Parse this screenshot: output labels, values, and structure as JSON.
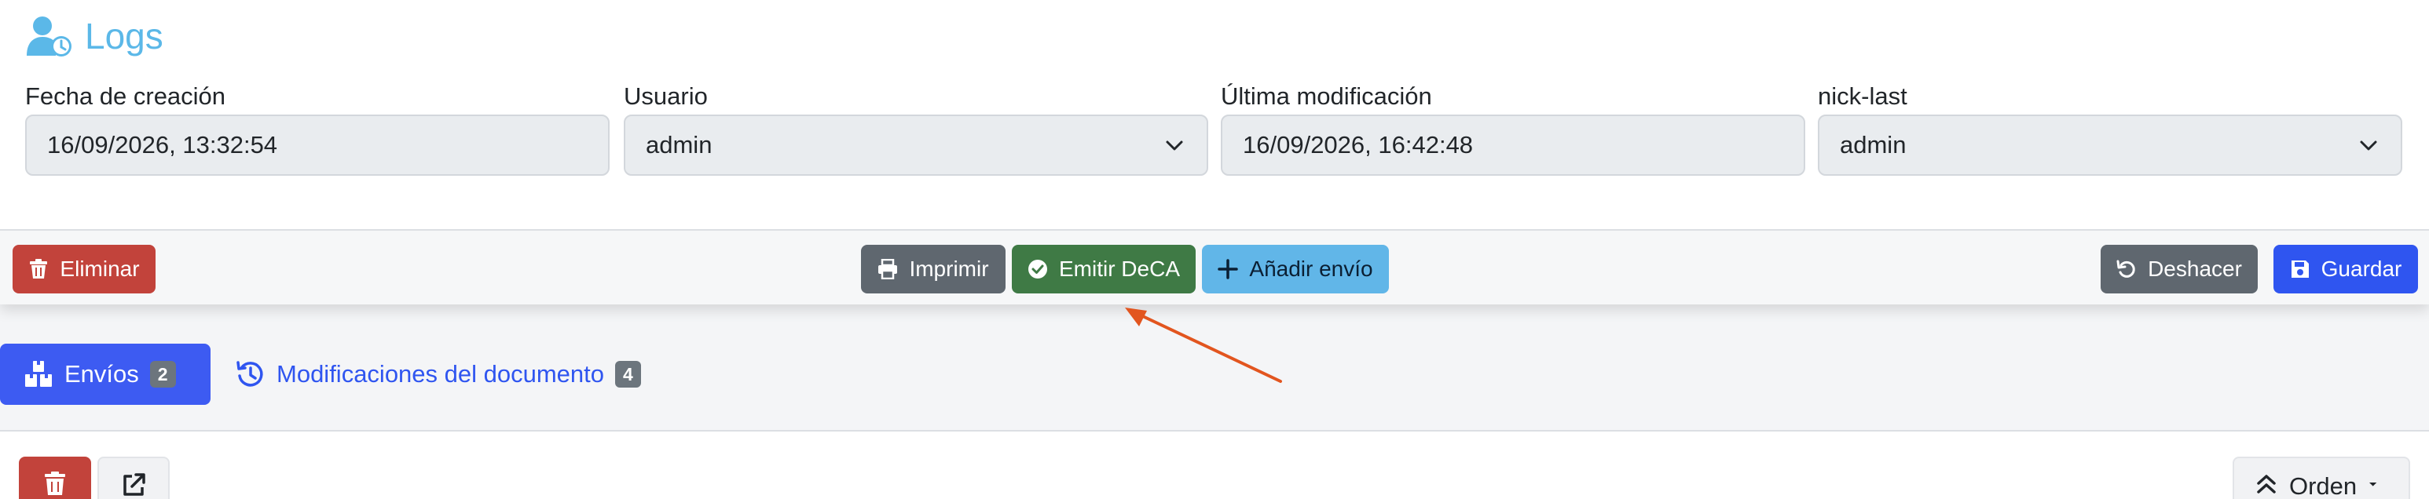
{
  "header": {
    "title": "Logs"
  },
  "fields": [
    {
      "label": "Fecha de creación",
      "value": "16/09/2026, 13:32:54",
      "type": "text"
    },
    {
      "label": "Usuario",
      "value": "admin",
      "type": "select"
    },
    {
      "label": "Última modificación",
      "value": "16/09/2026, 16:42:48",
      "type": "text"
    },
    {
      "label": "nick-last",
      "value": "admin",
      "type": "select"
    }
  ],
  "toolbar": {
    "delete_label": "Eliminar",
    "print_label": "Imprimir",
    "emit_label": "Emitir DeCA",
    "add_label": "Añadir envío",
    "undo_label": "Deshacer",
    "save_label": "Guardar"
  },
  "tabs": [
    {
      "label": "Envíos",
      "count": "2",
      "active": true
    },
    {
      "label": "Modificaciones del documento",
      "count": "4",
      "active": false
    }
  ],
  "panel": {
    "order_label": "Orden"
  },
  "colors": {
    "title": "#5bb8e8",
    "danger": "#c2433b",
    "secondary": "#5f676f",
    "success": "#3f7a45",
    "info": "#61b6e8",
    "primary": "#2f55f0",
    "annotation_arrow": "#e2551f"
  },
  "icons": {
    "title": "user-clock-icon",
    "delete": "trash-icon",
    "print": "printer-icon",
    "emit": "check-circle-icon",
    "add": "plus-icon",
    "undo": "undo-icon",
    "save": "save-icon",
    "shipments_tab": "boxes-icon",
    "history_tab": "history-icon",
    "external": "external-link-icon",
    "order": "chevrons-up-icon"
  }
}
